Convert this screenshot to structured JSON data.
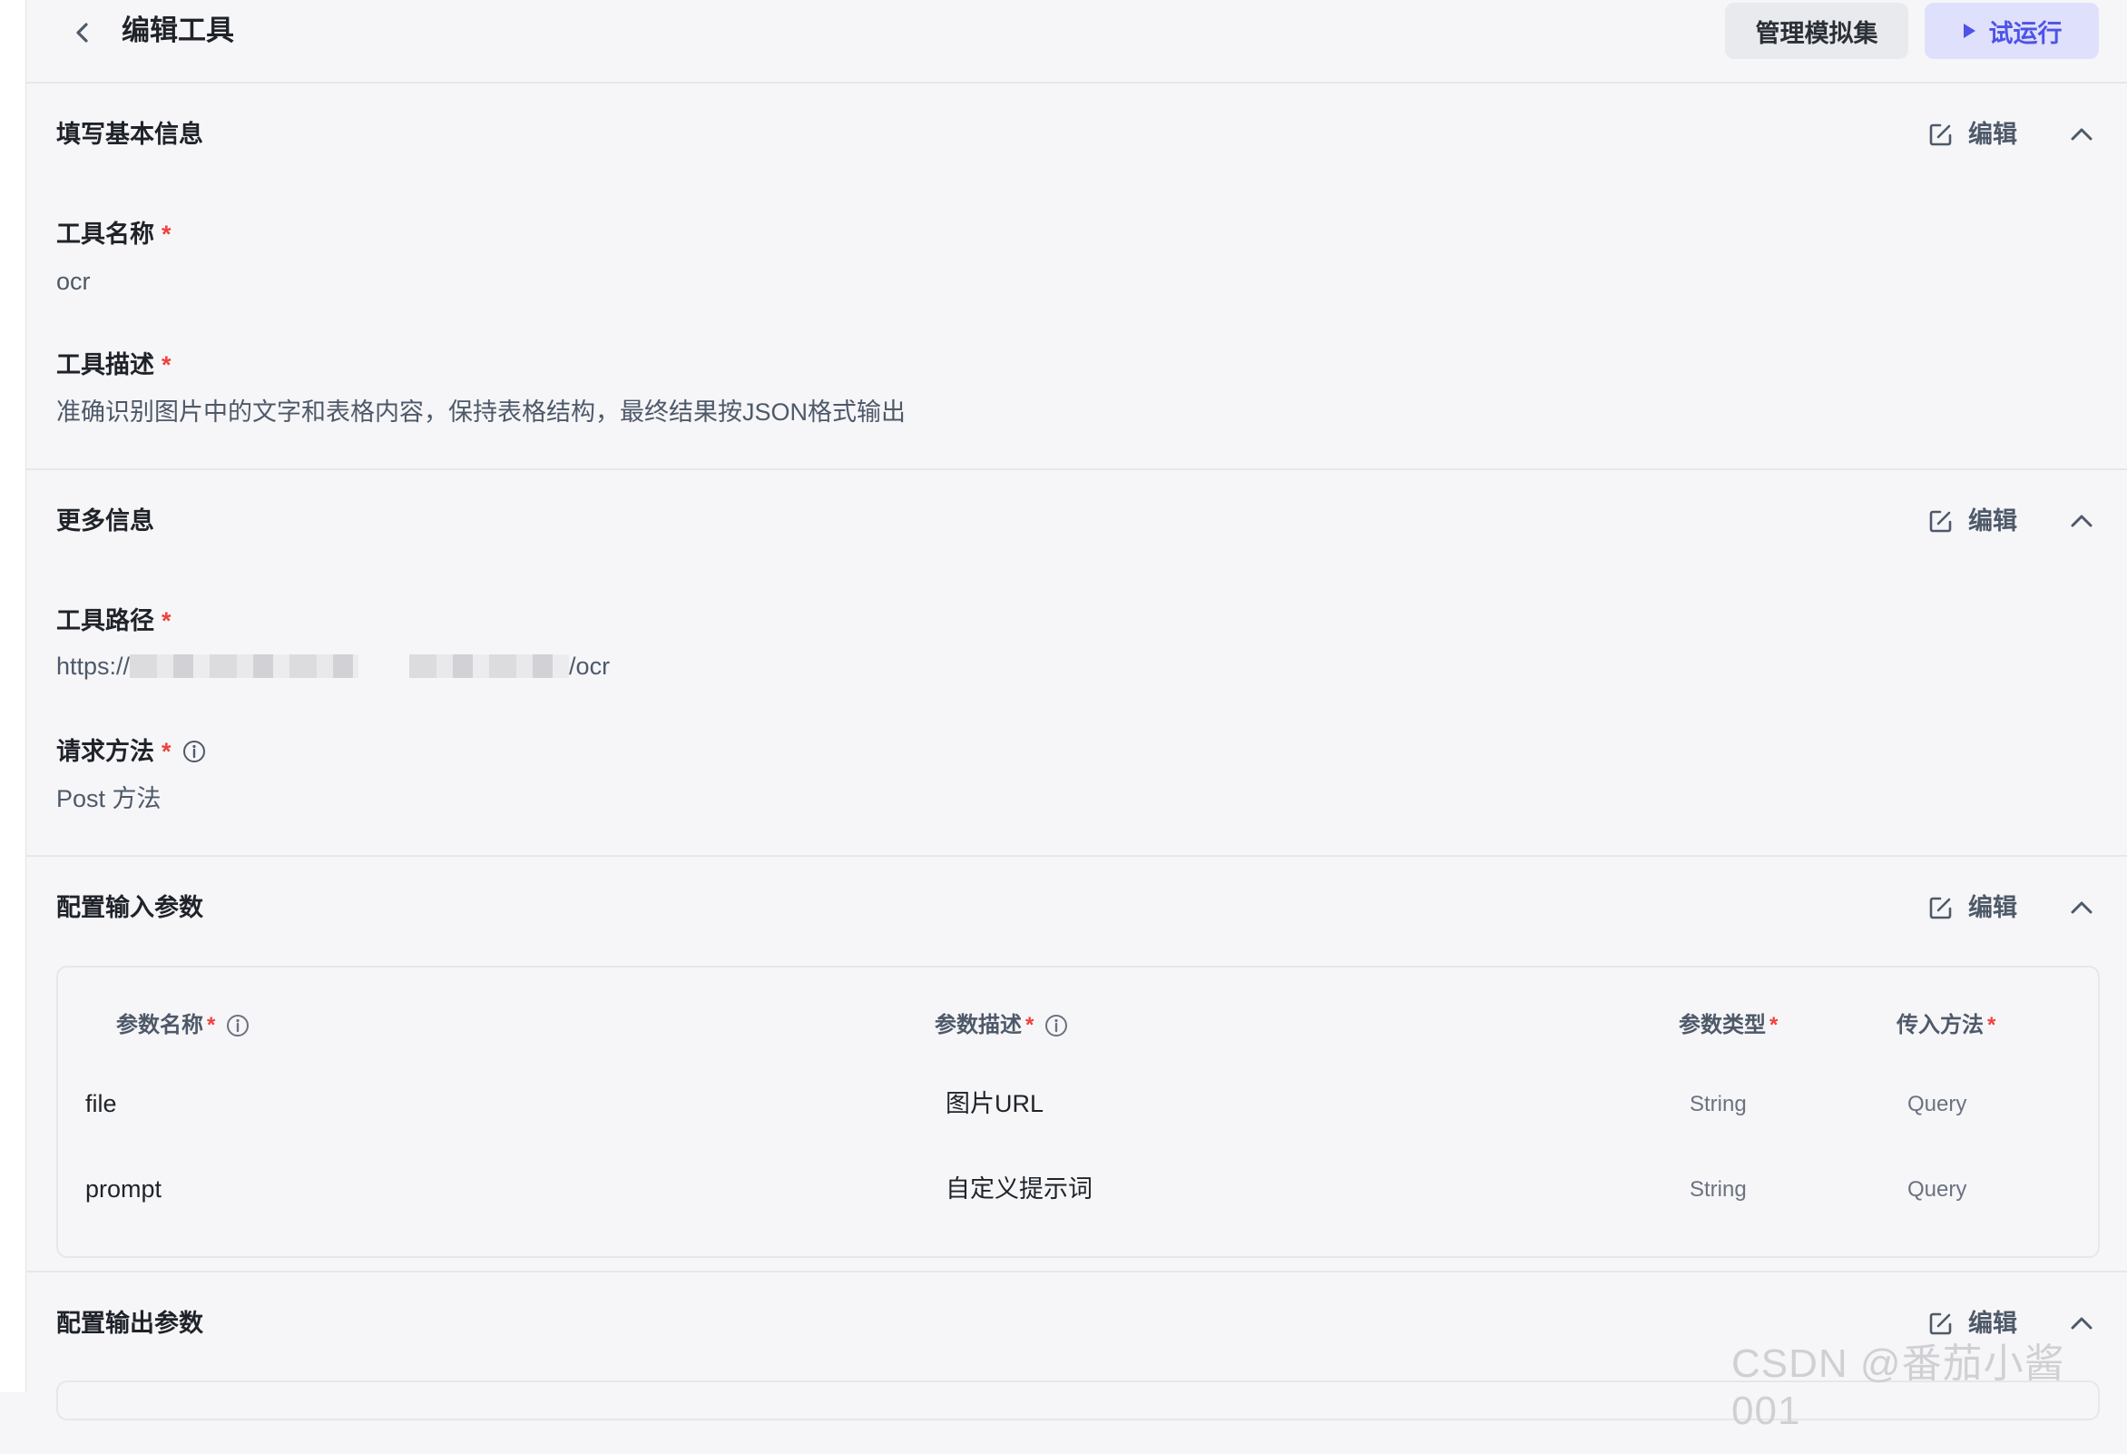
{
  "header": {
    "title": "编辑工具",
    "manage_label": "管理模拟集",
    "run_label": "试运行"
  },
  "basic": {
    "title": "填写基本信息",
    "edit_label": "编辑",
    "name_label": "工具名称",
    "name_value": "ocr",
    "desc_label": "工具描述",
    "desc_value": "准确识别图片中的文字和表格内容，保持表格结构，最终结果按JSON格式输出",
    "required_mark": "*"
  },
  "more": {
    "title": "更多信息",
    "edit_label": "编辑",
    "path_label": "工具路径",
    "path_prefix": "https://",
    "path_suffix": "/ocr",
    "method_label": "请求方法",
    "method_value": "Post 方法",
    "required_mark": "*"
  },
  "input": {
    "title": "配置输入参数",
    "edit_label": "编辑",
    "columns": [
      "参数名称",
      "参数描述",
      "参数类型",
      "传入方法"
    ],
    "required_mark": "*",
    "rows": [
      {
        "name": "file",
        "desc": "图片URL",
        "type": "String",
        "method": "Query"
      },
      {
        "name": "prompt",
        "desc": "自定义提示词",
        "type": "String",
        "method": "Query"
      }
    ]
  },
  "output": {
    "title": "配置输出参数",
    "edit_label": "编辑"
  },
  "watermark": "CSDN @番茄小酱001",
  "colors": {
    "accent": "#4d53e8",
    "required": "#f0413d",
    "background": "#f6f6f8"
  }
}
